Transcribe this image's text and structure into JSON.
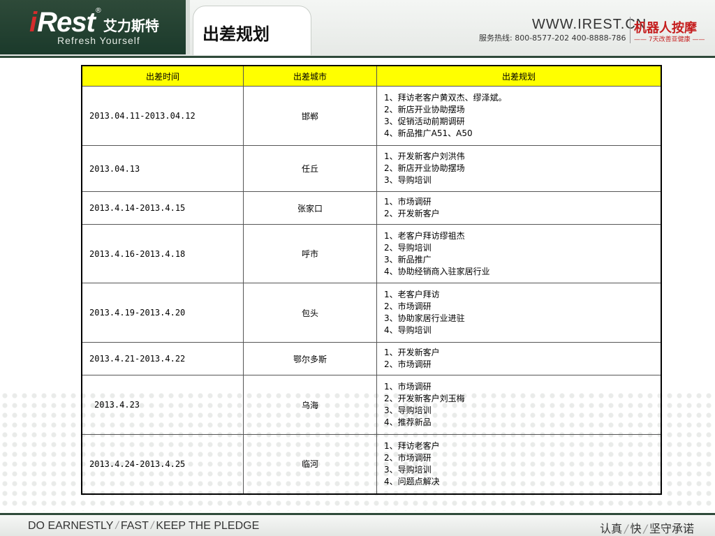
{
  "header": {
    "logo_i": "i",
    "logo_rest": "Rest",
    "logo_reg": "®",
    "logo_cn": "艾力斯特",
    "logo_sub": "Refresh Yourself",
    "title": "出差规划",
    "url": "WWW.IREST.CN",
    "hotline": "服务热线: 800-8577-202  400-8888-786",
    "brand_cn": "机器人按摩",
    "slogan_cn": "—— 7天改善亚健康 ——"
  },
  "table": {
    "headers": [
      "出差时间",
      "出差城市",
      "出差规划"
    ],
    "rows": [
      {
        "date": "2013.04.11-2013.04.12",
        "city": "邯郸",
        "plans": [
          "1、拜访老客户黄双杰、缪泽斌。",
          "2、新店开业协助摆场",
          "3、促销活动前期调研",
          "4、新品推广A51、A50"
        ]
      },
      {
        "date": "2013.04.13",
        "city": "任丘",
        "plans": [
          "1、开发新客户刘洪伟",
          "2、新店开业协助摆场",
          "3、导购培训"
        ]
      },
      {
        "date": "2013.4.14-2013.4.15",
        "city": "张家口",
        "plans": [
          "1、市场调研",
          "2、开发新客户"
        ]
      },
      {
        "date": "2013.4.16-2013.4.18",
        "city": "呼市",
        "plans": [
          "1、老客户拜访缪祖杰",
          "2、导购培训",
          "3、新品推广",
          "4、协助经销商入驻家居行业"
        ]
      },
      {
        "date": "2013.4.19-2013.4.20",
        "city": "包头",
        "plans": [
          "1、老客户拜访",
          "2、市场调研",
          "3、协助家居行业进驻",
          "4、导购培训"
        ]
      },
      {
        "date": "2013.4.21-2013.4.22",
        "city": "鄂尔多斯",
        "plans": [
          "1、开发新客户",
          "2、市场调研"
        ]
      },
      {
        "date": "2013.4.23",
        "city": "乌海",
        "plans": [
          "1、市场调研",
          "2、开发新客户刘玉梅",
          "3、导购培训",
          "4、推荐新品"
        ]
      },
      {
        "date": "2013.4.24-2013.4.25",
        "city": "临河",
        "plans": [
          "1、拜访老客户",
          "2、市场调研",
          "3、导购培训",
          "4、问题点解决"
        ]
      }
    ]
  },
  "footer": {
    "left_1": "DO EARNESTLY",
    "left_2": "FAST",
    "left_3": "KEEP THE PLEDGE",
    "right_1": "认真",
    "right_2": "快",
    "right_3": "坚守承诺",
    "sep": "/"
  }
}
